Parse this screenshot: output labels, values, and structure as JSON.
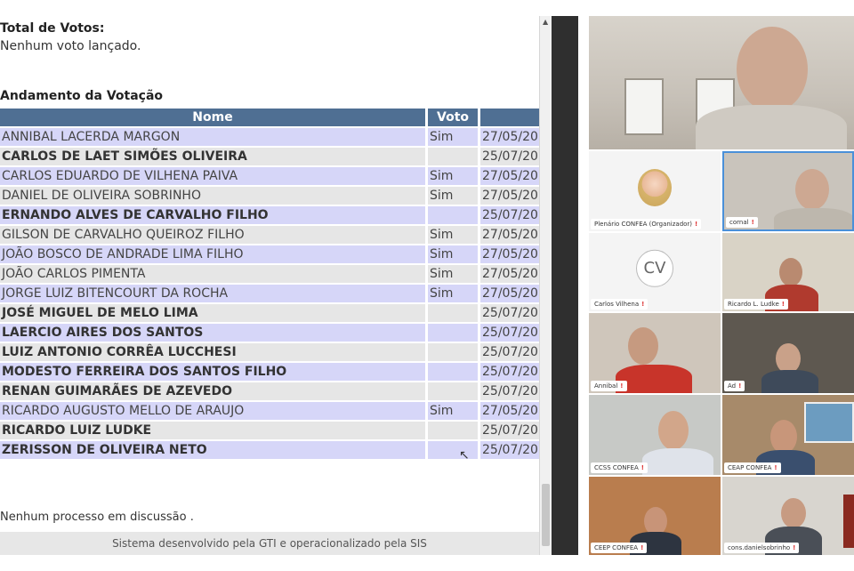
{
  "voting": {
    "total_title": "Total de Votos:",
    "total_text": "Nenhum voto lançado.",
    "progress_title": "Andamento da Votação",
    "columns": {
      "nome": "Nome",
      "voto": "Voto",
      "data": ""
    },
    "rows": [
      {
        "nome": "ANNIBAL LACERDA MARGON",
        "voto": "Sim",
        "data": "27/05/20"
      },
      {
        "nome": "CARLOS DE LAET SIMÕES OLIVEIRA",
        "voto": "",
        "data": "25/07/20"
      },
      {
        "nome": "CARLOS EDUARDO DE VILHENA PAIVA",
        "voto": "Sim",
        "data": "27/05/20"
      },
      {
        "nome": "DANIEL DE OLIVEIRA SOBRINHO",
        "voto": "Sim",
        "data": "27/05/20"
      },
      {
        "nome": "ERNANDO ALVES DE CARVALHO FILHO",
        "voto": "",
        "data": "25/07/20"
      },
      {
        "nome": "GILSON DE CARVALHO QUEIROZ FILHO",
        "voto": "Sim",
        "data": "27/05/20"
      },
      {
        "nome": "JOÃO BOSCO DE ANDRADE LIMA FILHO",
        "voto": "Sim",
        "data": "27/05/20"
      },
      {
        "nome": "JOÃO CARLOS PIMENTA",
        "voto": "Sim",
        "data": "27/05/20"
      },
      {
        "nome": "JORGE LUIZ BITENCOURT DA ROCHA",
        "voto": "Sim",
        "data": "27/05/20"
      },
      {
        "nome": "JOSÉ MIGUEL DE MELO LIMA",
        "voto": "",
        "data": "25/07/20"
      },
      {
        "nome": "LAERCIO AIRES DOS SANTOS",
        "voto": "",
        "data": "25/07/20"
      },
      {
        "nome": "LUIZ ANTONIO CORRÊA LUCCHESI",
        "voto": "",
        "data": "25/07/20"
      },
      {
        "nome": "MODESTO FERREIRA DOS SANTOS FILHO",
        "voto": "",
        "data": "25/07/20"
      },
      {
        "nome": "RENAN GUIMARÃES DE AZEVEDO",
        "voto": "",
        "data": "25/07/20"
      },
      {
        "nome": "RICARDO AUGUSTO MELLO DE ARAUJO",
        "voto": "Sim",
        "data": "27/05/20"
      },
      {
        "nome": "RICARDO LUIZ LUDKE",
        "voto": "",
        "data": "25/07/20"
      },
      {
        "nome": "ZERISSON DE OLIVEIRA NETO",
        "voto": "",
        "data": "25/07/20"
      }
    ],
    "no_process_text": "Nenhum processo em discussão .",
    "footer_text": "Sistema desenvolvido pela GTI e operacionalizado pela SIS"
  },
  "participants": [
    {
      "label": "Plenário CONFEA (Organizador)"
    },
    {
      "label": "cornal"
    },
    {
      "label": "Carlos Vilhena",
      "initials": "CV"
    },
    {
      "label": "Ricardo L. Ludke"
    },
    {
      "label": "Annibal"
    },
    {
      "label": "Ad"
    },
    {
      "label": "CCSS CONFEA"
    },
    {
      "label": "CEAP CONFEA"
    },
    {
      "label": "CEEP CONFEA"
    },
    {
      "label": "cons.danielsobrinho"
    }
  ],
  "colors": {
    "header_blue": "#4f6f93",
    "row_lilac": "#d6d6f8",
    "row_gray": "#e6e6e6"
  }
}
